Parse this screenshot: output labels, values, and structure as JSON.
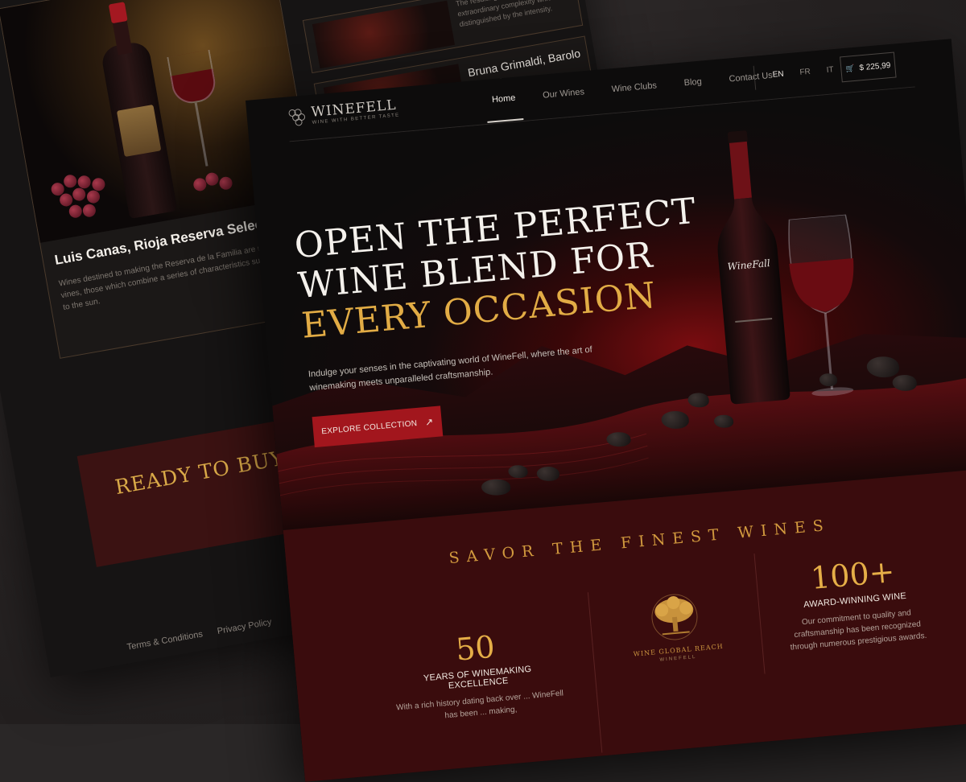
{
  "back_page": {
    "featured_wine": {
      "title": "Luis Canas, Rioja Reserva Seleccion",
      "description": "Wines destined to making the Reserva de la Familia are made from old vines, those which combine a series of characteristics such as exposure to the sun."
    },
    "snippet": "The resulting wine offers an extraordinary complexity which is distinguished by the intensity.",
    "second_wine": {
      "title": "Bruna Grimaldi, Barolo Badarina"
    },
    "cta_text": "READY TO BUY A BOTTLE OF WINE?",
    "footer_links": [
      "Terms & Conditions",
      "Privacy Policy"
    ],
    "social_icons": [
      "facebook-icon",
      "foursquare-icon",
      "linkedin-icon",
      "pinterest-icon",
      "twitter-icon"
    ]
  },
  "nav": {
    "logo": {
      "name": "WINEFELL",
      "tagline": "WINE WITH BETTER TASTE"
    },
    "menu": [
      "Home",
      "Our Wines",
      "Wine Clubs",
      "Blog",
      "Contact Us"
    ],
    "active_menu": "Home",
    "languages": [
      "EN",
      "FR",
      "IT"
    ],
    "active_language": "EN",
    "cart": {
      "amount": "$ 225,99",
      "icon": "cart-icon"
    }
  },
  "hero": {
    "headline_line1": "OPEN THE PERFECT",
    "headline_line2": "WINE BLEND FOR",
    "headline_line3": "EVERY OCCASION",
    "subtext": "Indulge your senses in the captivating world of WineFell, where the art of winemaking meets unparalleled craftsmanship.",
    "cta_label": "EXPLORE COLLECTION",
    "bottle_label": "WineFall"
  },
  "features": {
    "title": "SAVOR THE FINEST WINES",
    "stats": [
      {
        "number": "50",
        "label": "YEARS OF WINEMAKING EXCELLENCE",
        "description": "With a rich history dating back over ... WineFell has been ... making,"
      },
      {
        "number": "100+",
        "label": "AWARD-WINNING WINE",
        "description": "Our commitment to quality and craftsmanship has been recognized through numerous prestigious awards."
      }
    ],
    "emblem": {
      "title": "WINE GLOBAL REACH",
      "subtitle": "WINEFELL"
    }
  },
  "colors": {
    "accent_gold": "#e2ac45",
    "brand_red": "#a2161d",
    "band_maroon": "#3a0c0d",
    "background": "#0d0c0c"
  }
}
